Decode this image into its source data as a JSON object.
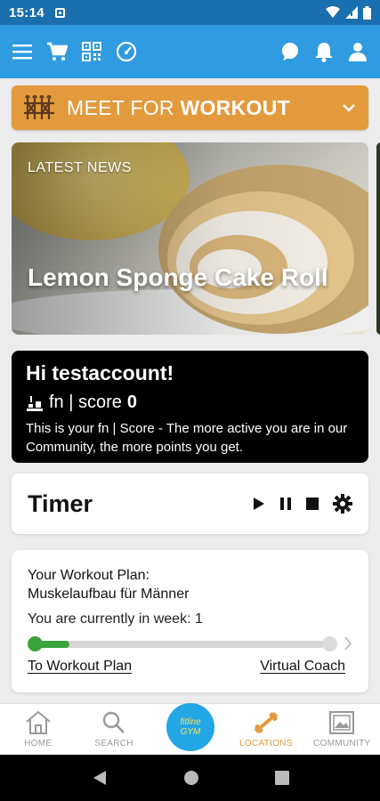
{
  "status_bar": {
    "time": "15:14"
  },
  "banner": {
    "text_normal": "MEET FOR ",
    "text_bold": "WORKOUT"
  },
  "news": {
    "label": "LATEST NEWS",
    "title": "Lemon Sponge Cake Roll"
  },
  "score_card": {
    "greeting": "Hi testaccount!",
    "fn_text": "fn | score",
    "score_value": "0",
    "description": "This is your fn | Score - The more active you are in our Community, the more points you get."
  },
  "timer": {
    "title": "Timer"
  },
  "workout_plan": {
    "title_line1": "Your Workout Plan:",
    "title_line2": "Muskelaufbau für Männer",
    "week_text": "You are currently in week: 1",
    "progress_fraction": 0.12,
    "link_plan": "To Workout Plan",
    "link_coach": "Virtual Coach"
  },
  "bottom_nav": {
    "items": [
      {
        "label": "HOME",
        "icon": "home-icon"
      },
      {
        "label": "SEARCH",
        "icon": "search-icon"
      },
      {
        "label": "LOCATIONS",
        "icon": "dumbbell-icon"
      },
      {
        "label": "COMMUNITY",
        "icon": "image-icon"
      }
    ],
    "logo_line1": "fitline",
    "logo_line2": "GYM"
  },
  "colors": {
    "status_bar": "#1a6fae",
    "app_bar": "#2f9be0",
    "banner": "#e39a3c",
    "progress": "#3aa33d",
    "active_nav": "#e39a3c"
  }
}
